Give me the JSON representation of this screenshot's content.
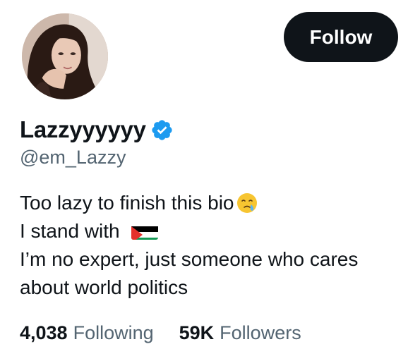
{
  "profile": {
    "display_name": "Lazzyyyyyy",
    "handle": "@em_Lazzy",
    "verified": true,
    "follow_label": "Follow"
  },
  "bio": {
    "line1": "Too lazy to finish this bio",
    "line1_emoji": "face-holding-back-tears-emoji",
    "line2": "I stand with",
    "line2_flag": "palestine-flag",
    "line3": "I’m no expert, just someone who cares",
    "line4": "about world politics"
  },
  "stats": {
    "following_count": "4,038",
    "following_label": "Following",
    "followers_count": "59K",
    "followers_label": "Followers"
  },
  "colors": {
    "text_primary": "#0f1419",
    "text_secondary": "#536471",
    "verified_blue": "#1d9bf0",
    "button_bg": "#0f1419"
  }
}
